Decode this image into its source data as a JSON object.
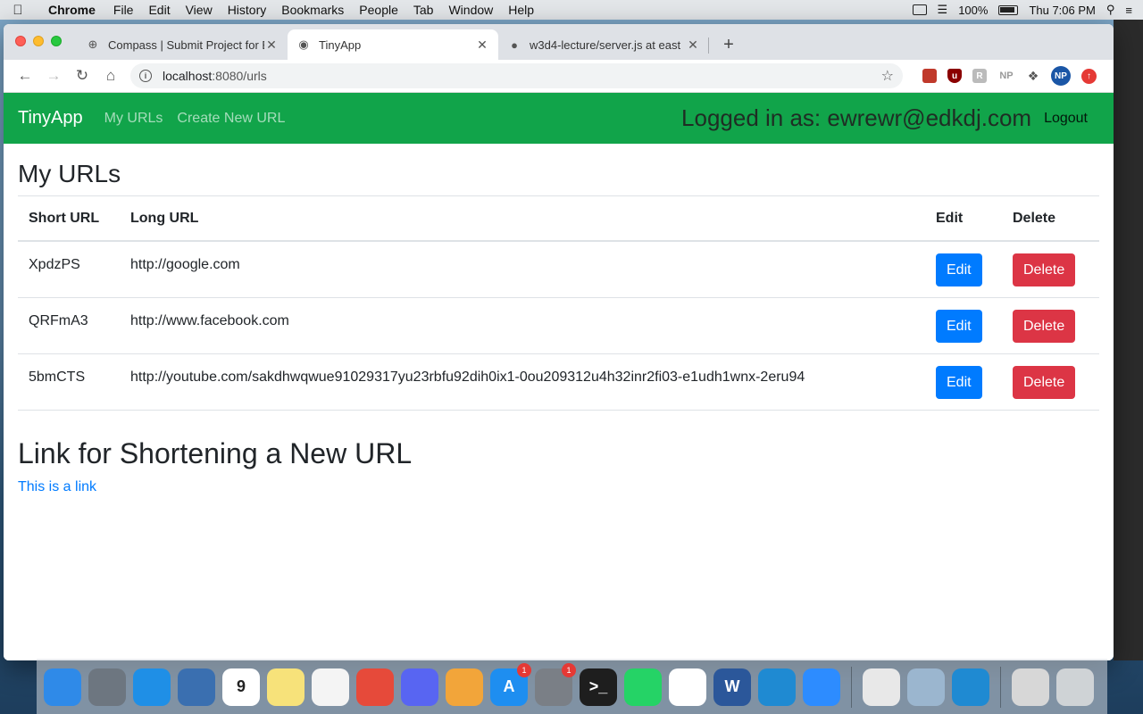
{
  "menubar": {
    "app": "Chrome",
    "items": [
      "File",
      "Edit",
      "View",
      "History",
      "Bookmarks",
      "People",
      "Tab",
      "Window",
      "Help"
    ],
    "battery": "100%",
    "clock": "Thu 7:06 PM"
  },
  "browser": {
    "tabs": [
      {
        "title": "Compass | Submit Project for E",
        "icon": "compass-icon",
        "active": false
      },
      {
        "title": "TinyApp",
        "icon": "globe-icon",
        "active": true
      },
      {
        "title": "w3d4-lecture/server.js at east",
        "icon": "github-icon",
        "active": false
      }
    ],
    "url_host": "localhost",
    "url_path": ":8080/urls",
    "extensions": [
      "bookmark-icon",
      "ublock-icon",
      "reader-icon",
      "np-icon",
      "puzzle-icon",
      "profile-avatar",
      "update-icon"
    ],
    "profile_initials": "NP",
    "np_label": "NP"
  },
  "app": {
    "brand": "TinyApp",
    "nav_links": [
      "My URLs",
      "Create New URL"
    ],
    "logged_in": "Logged in as: ewrewr@edkdj.com",
    "logout": "Logout",
    "accent": "#11a44a"
  },
  "urls_section": {
    "heading": "My URLs",
    "columns": [
      "Short URL",
      "Long URL",
      "Edit",
      "Delete"
    ],
    "rows": [
      {
        "short": "XpdzPS",
        "long": "http://google.com",
        "edit": "Edit",
        "delete": "Delete"
      },
      {
        "short": "QRFmA3",
        "long": "http://www.facebook.com",
        "edit": "Edit",
        "delete": "Delete"
      },
      {
        "short": "5bmCTS",
        "long": "http://youtube.com/sakdhwqwue91029317yu23rbfu92dih0ix1-0ou209312u4h32inr2fi03-e1udh1wnx-2eru94",
        "edit": "Edit",
        "delete": "Delete"
      }
    ]
  },
  "shorten_section": {
    "heading": "Link for Shortening a New URL",
    "link": "This is a link"
  },
  "dock": {
    "apps": [
      {
        "name": "finder-icon",
        "color": "#2f8ae8",
        "label": "",
        "badge": ""
      },
      {
        "name": "launchpad-icon",
        "color": "#6d7680",
        "label": "",
        "badge": ""
      },
      {
        "name": "safari-icon",
        "color": "#1f8fe6",
        "label": "",
        "badge": ""
      },
      {
        "name": "preview-app-icon",
        "color": "#3a6fb0",
        "label": "",
        "badge": ""
      },
      {
        "name": "calendar-icon",
        "color": "#ffffff",
        "label": "9",
        "badge": ""
      },
      {
        "name": "notes-icon",
        "color": "#f7e27a",
        "label": "",
        "badge": ""
      },
      {
        "name": "reminders-icon",
        "color": "#f4f4f4",
        "label": "",
        "badge": ""
      },
      {
        "name": "chrome-icon",
        "color": "#e64a3a",
        "label": "",
        "badge": ""
      },
      {
        "name": "discord-icon",
        "color": "#5865f2",
        "label": "",
        "badge": ""
      },
      {
        "name": "photos-icon",
        "color": "#f2a53a",
        "label": "",
        "badge": ""
      },
      {
        "name": "app-store-icon",
        "color": "#1e8ef0",
        "label": "A",
        "badge": "1"
      },
      {
        "name": "system-preferences-icon",
        "color": "#7a7f86",
        "label": "",
        "badge": "1"
      },
      {
        "name": "terminal-icon",
        "color": "#1e1e1e",
        "label": ">_",
        "badge": ""
      },
      {
        "name": "whatsapp-icon",
        "color": "#25d366",
        "label": "",
        "badge": ""
      },
      {
        "name": "slack-icon",
        "color": "#ffffff",
        "label": "",
        "badge": ""
      },
      {
        "name": "word-icon",
        "color": "#2b579a",
        "label": "W",
        "badge": ""
      },
      {
        "name": "vscode-icon",
        "color": "#1f8ad2",
        "label": "",
        "badge": ""
      },
      {
        "name": "zoom-icon",
        "color": "#2d8cff",
        "label": "",
        "badge": ""
      }
    ],
    "docs": [
      {
        "name": "document-stack-icon",
        "color": "#e8e8e8"
      },
      {
        "name": "image-stack-icon",
        "color": "#9bb6cf"
      },
      {
        "name": "vscode-stack-icon",
        "color": "#1f8ad2"
      }
    ],
    "tail": [
      {
        "name": "downloads-icon",
        "color": "#d7d7d7"
      },
      {
        "name": "trash-icon",
        "color": "#cfd3d6"
      }
    ]
  }
}
